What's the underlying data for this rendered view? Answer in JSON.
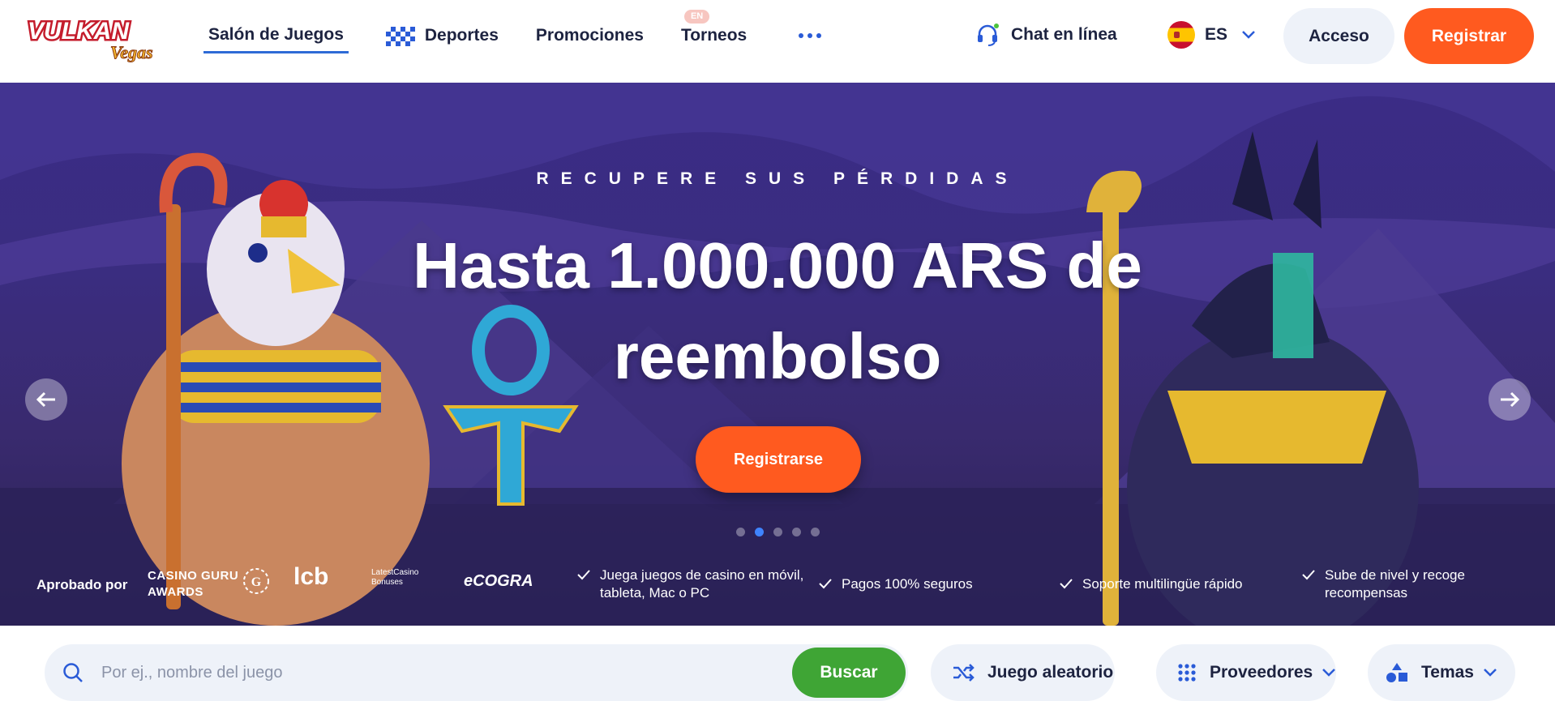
{
  "header": {
    "logo_text": "VULKAN Vegas",
    "nav": [
      {
        "label": "Salón de Juegos"
      },
      {
        "label": "Deportes"
      },
      {
        "label": "Promociones"
      },
      {
        "label": "Torneos",
        "badge": "EN"
      }
    ],
    "chat_label": "Chat en línea",
    "language": "ES",
    "login_label": "Acceso",
    "register_label": "Registrar"
  },
  "hero": {
    "eyebrow": "RECUPERE SUS PÉRDIDAS",
    "title": "Hasta 1.000.000 ARS de reembolso",
    "cta_label": "Registrarse",
    "slides_total": 5,
    "active_slide": 2
  },
  "trust": {
    "approved_label": "Aprobado por",
    "awards_line1": "CASINO GURU",
    "awards_line2": "AWARDS",
    "partner_lcb": "lcb",
    "partner_latest": "LatestCasino Bonuses",
    "partner_ecogra": "eCOGRA",
    "features": [
      "Juega juegos de casino en móvil, tableta, Mac o PC",
      "Pagos 100% seguros",
      "Soporte multilingüe rápido",
      "Sube de nivel y recoge recompensas"
    ]
  },
  "search": {
    "placeholder": "Por ej., nombre del juego",
    "button_label": "Buscar",
    "random_label": "Juego aleatorio",
    "providers_label": "Proveedores",
    "themes_label": "Temas"
  },
  "colors": {
    "accent_orange": "#ff5a1f",
    "accent_blue": "#2e6bd6",
    "search_green": "#3fa535",
    "pill_bg": "#eef2f9",
    "text_dark": "#1d2340"
  }
}
